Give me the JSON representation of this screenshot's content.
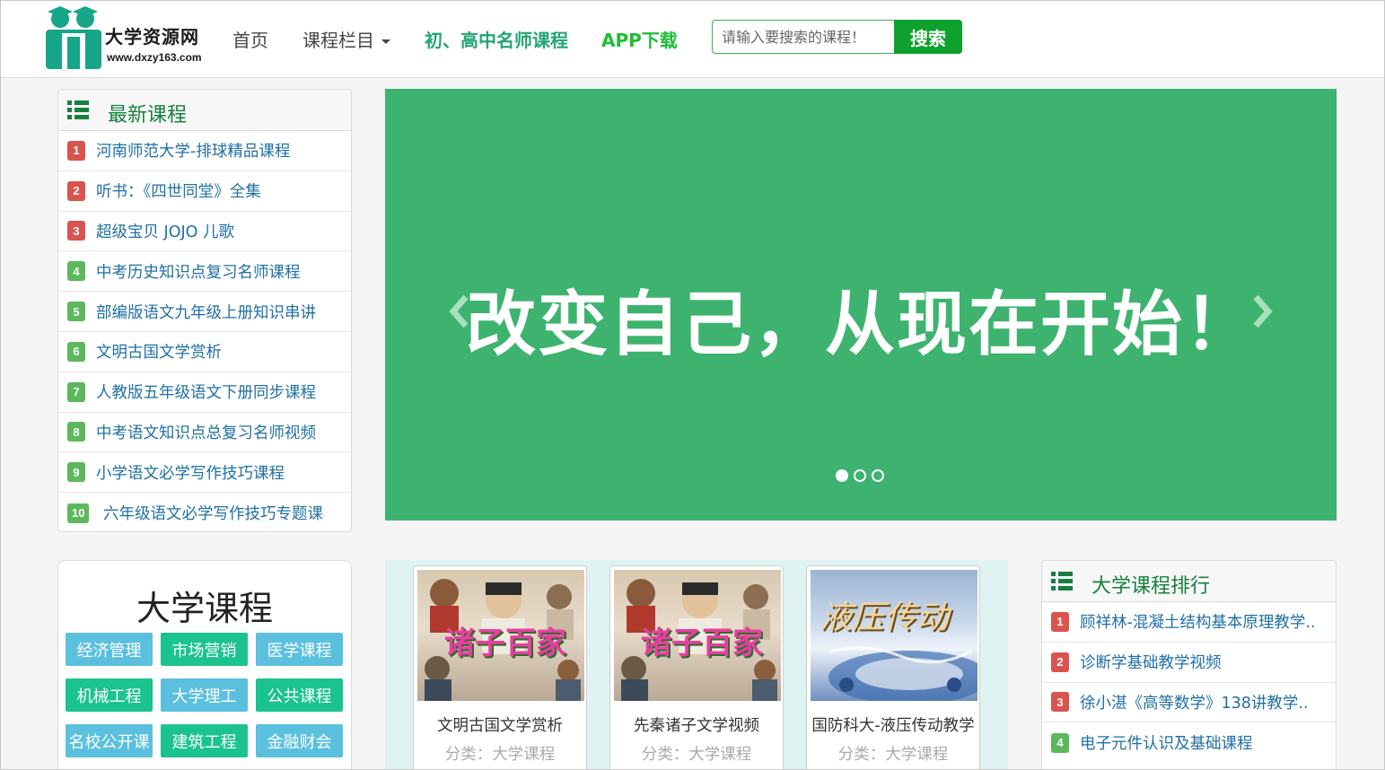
{
  "header": {
    "logo_name": "大学资源网",
    "logo_url": "www.dxzy163.com",
    "nav": {
      "home": "首页",
      "columns": "课程栏目",
      "teacher": "初、高中名师课程",
      "app": "APP下载"
    },
    "search": {
      "placeholder": "请输入要搜索的课程！",
      "button": "搜索"
    },
    "colors": {
      "teacher": "#21a672",
      "app": "#1ebd36",
      "search_button": "#0fa12d"
    }
  },
  "latest": {
    "title": "最新课程",
    "items": [
      {
        "rank": "1",
        "title": "河南师范大学-排球精品课程"
      },
      {
        "rank": "2",
        "title": "听书：《四世同堂》全集"
      },
      {
        "rank": "3",
        "title": "超级宝贝 JOJO 儿歌"
      },
      {
        "rank": "4",
        "title": "中考历史知识点复习名师课程"
      },
      {
        "rank": "5",
        "title": "部编版语文九年级上册知识串讲"
      },
      {
        "rank": "6",
        "title": "文明古国文学赏析"
      },
      {
        "rank": "7",
        "title": "人教版五年级语文下册同步课程"
      },
      {
        "rank": "8",
        "title": "中考语文知识点总复习名师视频"
      },
      {
        "rank": "9",
        "title": "小学语文必学写作技巧课程"
      },
      {
        "rank": "10",
        "title": "六年级语文必学写作技巧专题课"
      }
    ]
  },
  "banner": {
    "text": "改变自己，从现在开始！",
    "color": "#3db36f",
    "slides_total": 3,
    "active_slide": 1
  },
  "categories": {
    "title": "大学课程",
    "buttons": [
      "经济管理",
      "市场营销",
      "医学课程",
      "机械工程",
      "大学理工",
      "公共课程",
      "名校公开课",
      "建筑工程",
      "金融财会"
    ]
  },
  "courses": [
    {
      "name": "文明古国文学赏析",
      "category": "分类：大学课程",
      "thumb_text": "诸子百家"
    },
    {
      "name": "先秦诸子文学视频",
      "category": "分类：大学课程",
      "thumb_text": "诸子百家"
    },
    {
      "name": "国防科大-液压传动教学",
      "category": "分类：大学课程",
      "thumb_text": "液压传动"
    }
  ],
  "ranking": {
    "title": "大学课程排行",
    "items": [
      {
        "rank": "1",
        "title": "顾祥林-混凝土结构基本原理教学.."
      },
      {
        "rank": "2",
        "title": "诊断学基础教学视频"
      },
      {
        "rank": "3",
        "title": "徐小湛《高等数学》138讲教学.."
      },
      {
        "rank": "4",
        "title": "电子元件认识及基础课程"
      }
    ]
  }
}
